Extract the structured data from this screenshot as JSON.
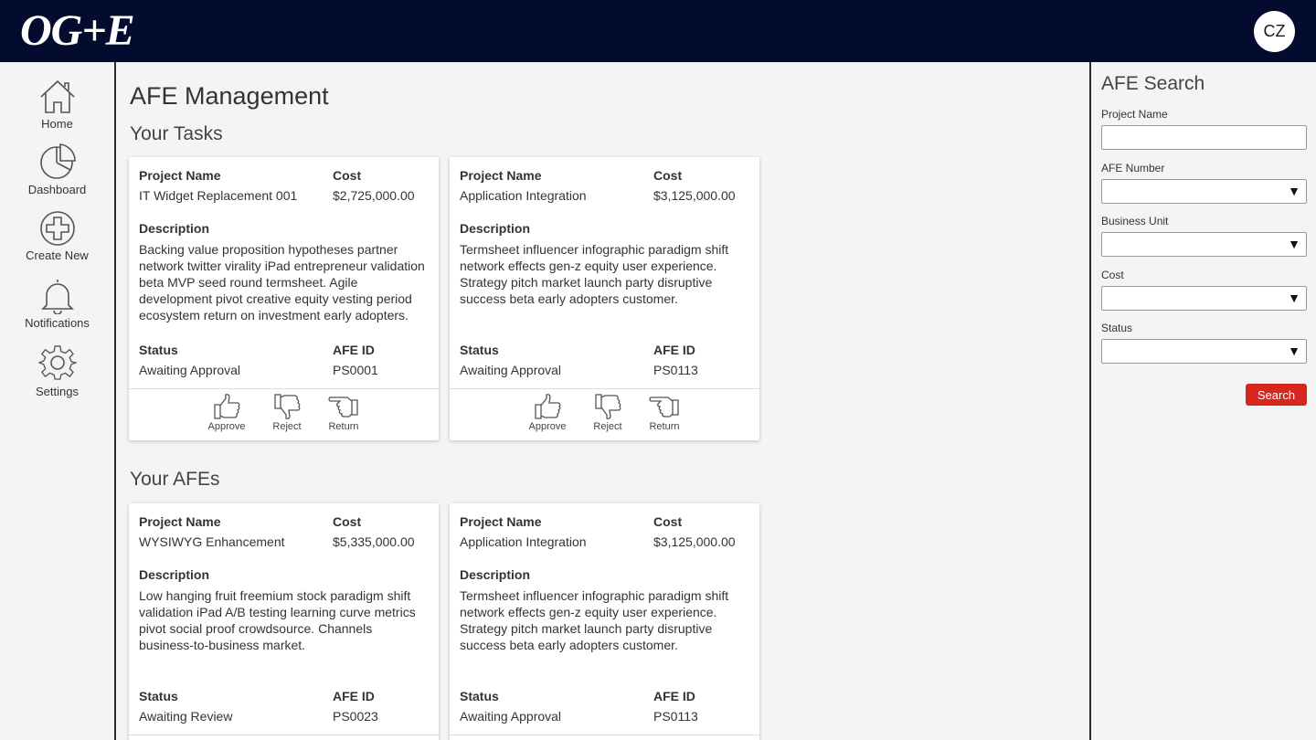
{
  "header": {
    "logo": "OG+E",
    "avatar_initials": "CZ"
  },
  "sidebar": {
    "items": [
      {
        "label": "Home",
        "icon": "home-icon"
      },
      {
        "label": "Dashboard",
        "icon": "pie-chart-icon"
      },
      {
        "label": "Create New",
        "icon": "plus-circle-icon"
      },
      {
        "label": "Notifications",
        "icon": "bell-icon"
      },
      {
        "label": "Settings",
        "icon": "gear-icon"
      }
    ]
  },
  "main": {
    "title": "AFE Management",
    "tasks_title": "Your Tasks",
    "afes_title": "Your AFEs",
    "field_labels": {
      "project_name": "Project Name",
      "cost": "Cost",
      "description": "Description",
      "status": "Status",
      "afe_id": "AFE ID"
    },
    "actions": {
      "approve": "Approve",
      "reject": "Reject",
      "return": "Return"
    },
    "tasks": [
      {
        "project_name": "IT Widget Replacement 001",
        "cost": "$2,725,000.00",
        "description": "Backing value proposition hypotheses partner network twitter virality iPad entrepreneur validation beta MVP seed round termsheet. Agile development pivot creative equity vesting period ecosystem return on investment early adopters.",
        "status": "Awaiting Approval",
        "afe_id": "PS0001"
      },
      {
        "project_name": "Application Integration",
        "cost": "$3,125,000.00",
        "description": "Termsheet influencer infographic paradigm shift network effects gen-z equity user experience. Strategy pitch market launch party disruptive success beta early adopters customer.",
        "status": "Awaiting Approval",
        "afe_id": "PS0113"
      }
    ],
    "afes": [
      {
        "project_name": "WYSIWYG Enhancement",
        "cost": "$5,335,000.00",
        "description": "Low hanging fruit freemium stock paradigm shift validation iPad A/B testing learning curve metrics pivot social proof crowdsource. Channels business-to-business market.",
        "status": "Awaiting Review",
        "afe_id": "PS0023"
      },
      {
        "project_name": "Application Integration",
        "cost": "$3,125,000.00",
        "description": "Termsheet influencer infographic paradigm shift network effects gen-z equity user experience. Strategy pitch market launch party disruptive success beta early adopters customer.",
        "status": "Awaiting Approval",
        "afe_id": "PS0113"
      }
    ]
  },
  "search": {
    "title": "AFE Search",
    "project_name_label": "Project Name",
    "project_name_value": "",
    "afe_number_label": "AFE Number",
    "afe_number_value": "",
    "business_unit_label": "Business Unit",
    "business_unit_value": "",
    "cost_label": "Cost",
    "cost_value": "",
    "status_label": "Status",
    "status_value": "",
    "button_label": "Search"
  },
  "colors": {
    "header_bg": "#030c2e",
    "search_button": "#d7261e"
  }
}
